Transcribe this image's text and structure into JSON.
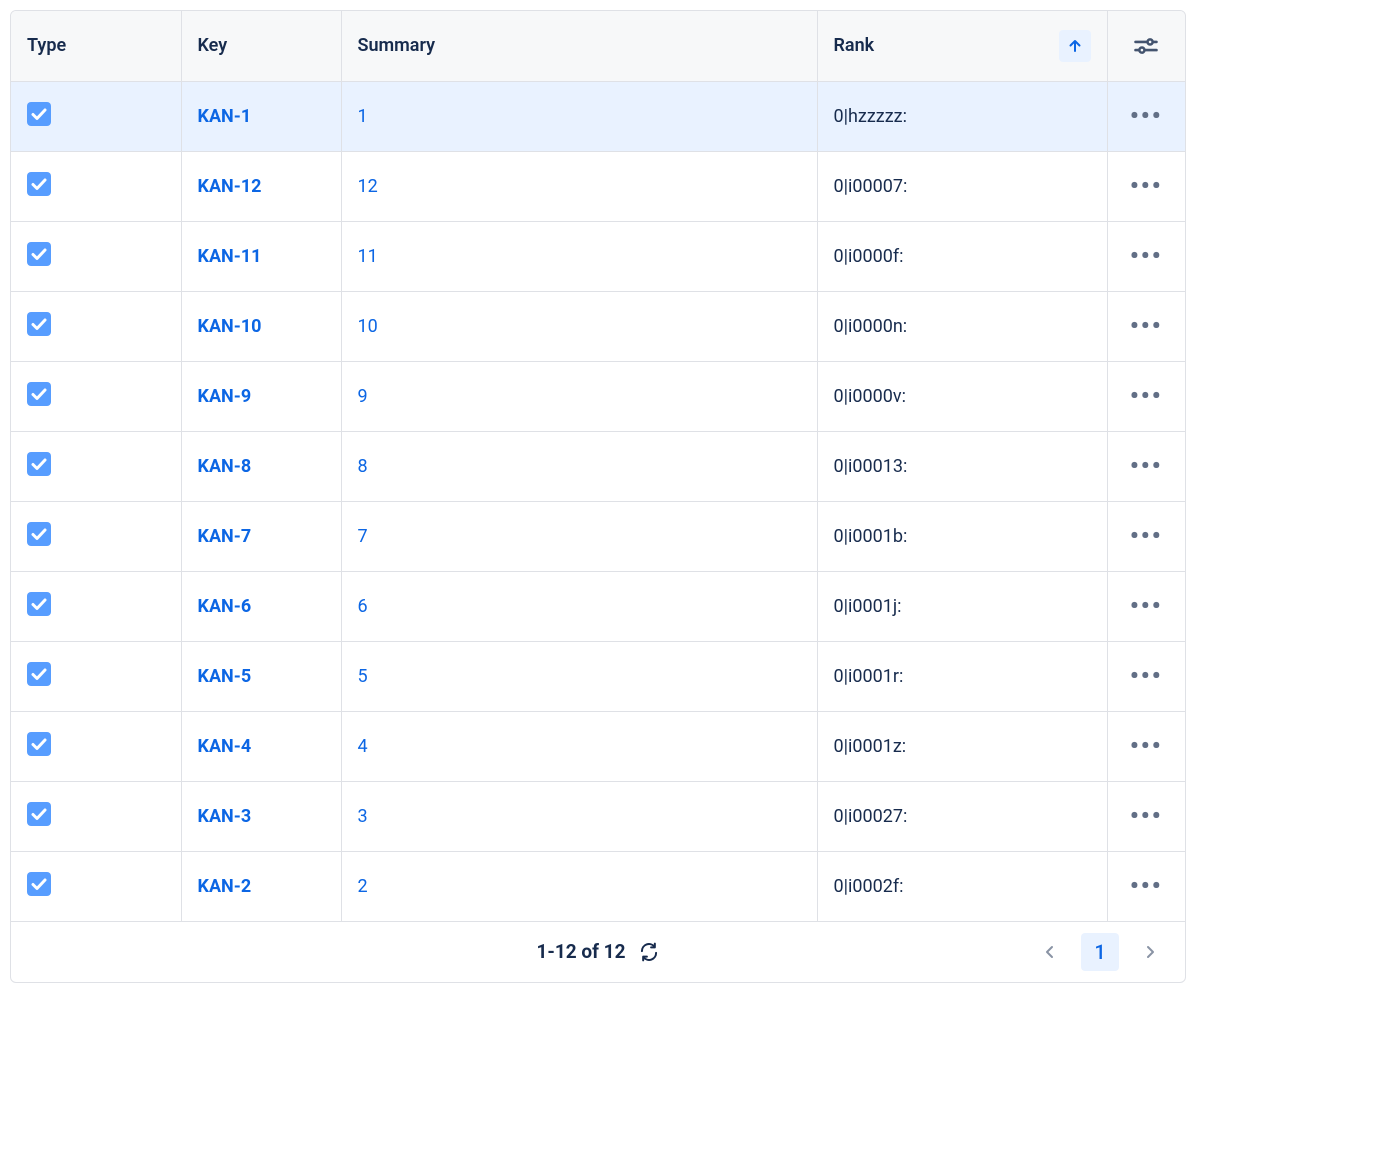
{
  "columns": {
    "type_label": "Type",
    "key_label": "Key",
    "summary_label": "Summary",
    "rank_label": "Rank",
    "rank_sort": "asc"
  },
  "rows": [
    {
      "selected": true,
      "key": "KAN-1",
      "summary": "1",
      "rank": "0|hzzzzz:"
    },
    {
      "selected": false,
      "key": "KAN-12",
      "summary": "12",
      "rank": "0|i00007:"
    },
    {
      "selected": false,
      "key": "KAN-11",
      "summary": "11",
      "rank": "0|i0000f:"
    },
    {
      "selected": false,
      "key": "KAN-10",
      "summary": "10",
      "rank": "0|i0000n:"
    },
    {
      "selected": false,
      "key": "KAN-9",
      "summary": "9",
      "rank": "0|i0000v:"
    },
    {
      "selected": false,
      "key": "KAN-8",
      "summary": "8",
      "rank": "0|i00013:"
    },
    {
      "selected": false,
      "key": "KAN-7",
      "summary": "7",
      "rank": "0|i0001b:"
    },
    {
      "selected": false,
      "key": "KAN-6",
      "summary": "6",
      "rank": "0|i0001j:"
    },
    {
      "selected": false,
      "key": "KAN-5",
      "summary": "5",
      "rank": "0|i0001r:"
    },
    {
      "selected": false,
      "key": "KAN-4",
      "summary": "4",
      "rank": "0|i0001z:"
    },
    {
      "selected": false,
      "key": "KAN-3",
      "summary": "3",
      "rank": "0|i00027:"
    },
    {
      "selected": false,
      "key": "KAN-2",
      "summary": "2",
      "rank": "0|i0002f:"
    }
  ],
  "footer": {
    "pagination_text": "1-12 of 12",
    "current_page": "1"
  }
}
